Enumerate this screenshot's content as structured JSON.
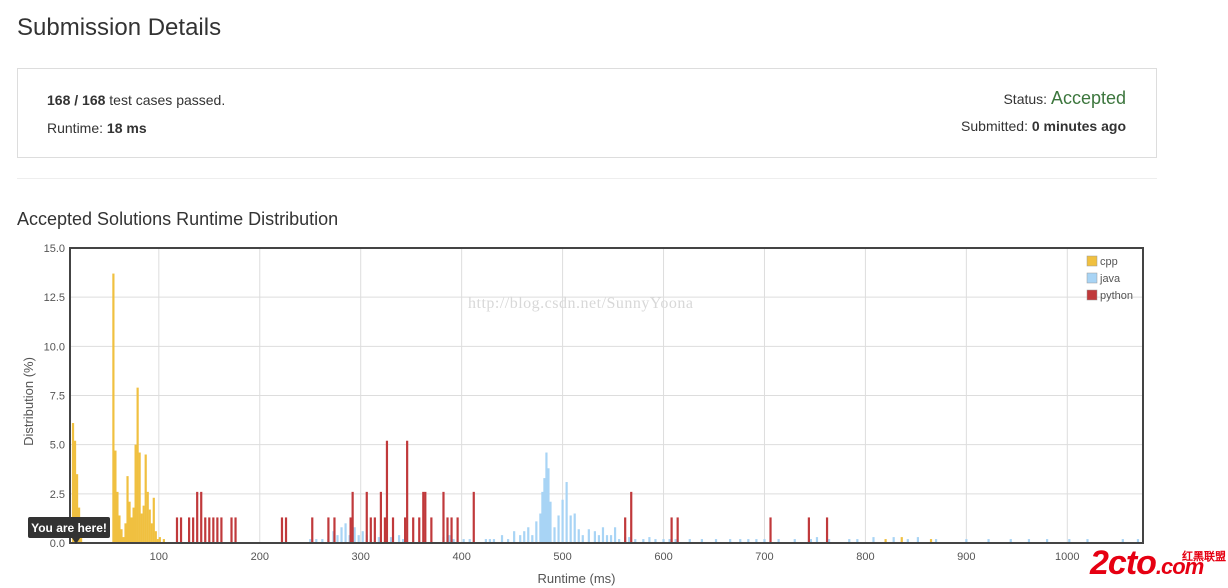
{
  "page": {
    "title": "Submission Details"
  },
  "summary": {
    "passed": "168 / 168",
    "passed_suffix": " test cases passed.",
    "runtime_label": "Runtime: ",
    "runtime_value": "18 ms",
    "status_label": "Status: ",
    "status_value": "Accepted",
    "submitted_label": "Submitted: ",
    "submitted_value": "0 minutes ago",
    "status_color": "#3c763d"
  },
  "chart_title": "Accepted Solutions Runtime Distribution",
  "watermark": "http://blog.csdn.net/SunnyYoona",
  "logo": {
    "main": "2cto",
    "tld": ".com",
    "sub": "红黑联盟"
  },
  "chart_data": {
    "type": "bar",
    "title": "Accepted Solutions Runtime Distribution",
    "xlabel": "Runtime (ms)",
    "ylabel": "Distribution (%)",
    "xlim": [
      12,
      1075
    ],
    "ylim": [
      0,
      15
    ],
    "x_ticks": [
      "100",
      "200",
      "300",
      "400",
      "500",
      "600",
      "700",
      "800",
      "900",
      "1000"
    ],
    "x_tick_values": [
      100,
      200,
      300,
      400,
      500,
      600,
      700,
      800,
      900,
      1000
    ],
    "y_ticks": [
      "0.0",
      "2.5",
      "5.0",
      "7.5",
      "10.0",
      "12.5",
      "15.0"
    ],
    "y_tick_values": [
      0,
      2.5,
      5,
      7.5,
      10,
      12.5,
      15
    ],
    "grid": true,
    "legend_position": "top-right",
    "annotation": {
      "text": "You are here!",
      "x": 18
    },
    "series": [
      {
        "name": "cpp",
        "color": "#f0c040",
        "points": [
          [
            15,
            6.1
          ],
          [
            17,
            5.2
          ],
          [
            19,
            3.5
          ],
          [
            21,
            1.8
          ],
          [
            23,
            1.0
          ],
          [
            55,
            13.7
          ],
          [
            57,
            4.7
          ],
          [
            59,
            2.6
          ],
          [
            61,
            1.4
          ],
          [
            63,
            0.7
          ],
          [
            65,
            0.3
          ],
          [
            67,
            1.0
          ],
          [
            69,
            3.4
          ],
          [
            71,
            2.1
          ],
          [
            73,
            1.3
          ],
          [
            75,
            1.8
          ],
          [
            77,
            5.0
          ],
          [
            79,
            7.9
          ],
          [
            81,
            4.6
          ],
          [
            83,
            1.5
          ],
          [
            85,
            1.9
          ],
          [
            87,
            4.5
          ],
          [
            89,
            2.6
          ],
          [
            91,
            1.7
          ],
          [
            93,
            1.0
          ],
          [
            95,
            2.3
          ],
          [
            97,
            0.6
          ],
          [
            99,
            0.2
          ],
          [
            101,
            0.3
          ],
          [
            105,
            0.2
          ],
          [
            820,
            0.2
          ],
          [
            836,
            0.3
          ],
          [
            865,
            0.2
          ]
        ]
      },
      {
        "name": "java",
        "color": "#a8d4f5",
        "points": [
          [
            250,
            0.2
          ],
          [
            256,
            0.2
          ],
          [
            262,
            0.2
          ],
          [
            268,
            0.2
          ],
          [
            273,
            0.6
          ],
          [
            277,
            0.4
          ],
          [
            281,
            0.8
          ],
          [
            285,
            1.0
          ],
          [
            289,
            0.4
          ],
          [
            294,
            0.8
          ],
          [
            298,
            0.4
          ],
          [
            302,
            0.6
          ],
          [
            306,
            0.4
          ],
          [
            310,
            0.2
          ],
          [
            318,
            0.3
          ],
          [
            330,
            0.3
          ],
          [
            338,
            0.4
          ],
          [
            342,
            0.2
          ],
          [
            382,
            0.3
          ],
          [
            388,
            0.4
          ],
          [
            392,
            0.2
          ],
          [
            402,
            0.2
          ],
          [
            408,
            0.2
          ],
          [
            424,
            0.2
          ],
          [
            428,
            0.2
          ],
          [
            432,
            0.2
          ],
          [
            440,
            0.4
          ],
          [
            446,
            0.2
          ],
          [
            452,
            0.6
          ],
          [
            458,
            0.4
          ],
          [
            462,
            0.6
          ],
          [
            466,
            0.8
          ],
          [
            470,
            0.4
          ],
          [
            474,
            1.1
          ],
          [
            478,
            1.5
          ],
          [
            480,
            2.6
          ],
          [
            482,
            3.3
          ],
          [
            484,
            4.6
          ],
          [
            486,
            3.8
          ],
          [
            488,
            2.1
          ],
          [
            492,
            0.8
          ],
          [
            496,
            1.4
          ],
          [
            500,
            2.2
          ],
          [
            504,
            3.1
          ],
          [
            508,
            1.4
          ],
          [
            512,
            1.5
          ],
          [
            516,
            0.7
          ],
          [
            520,
            0.4
          ],
          [
            526,
            0.7
          ],
          [
            532,
            0.6
          ],
          [
            536,
            0.4
          ],
          [
            540,
            0.8
          ],
          [
            544,
            0.4
          ],
          [
            548,
            0.4
          ],
          [
            552,
            0.8
          ],
          [
            556,
            0.2
          ],
          [
            562,
            0.3
          ],
          [
            566,
            0.3
          ],
          [
            572,
            0.2
          ],
          [
            580,
            0.2
          ],
          [
            586,
            0.3
          ],
          [
            592,
            0.2
          ],
          [
            600,
            0.2
          ],
          [
            606,
            0.2
          ],
          [
            612,
            0.2
          ],
          [
            626,
            0.2
          ],
          [
            638,
            0.2
          ],
          [
            652,
            0.2
          ],
          [
            666,
            0.2
          ],
          [
            676,
            0.2
          ],
          [
            684,
            0.2
          ],
          [
            692,
            0.2
          ],
          [
            700,
            0.2
          ],
          [
            714,
            0.2
          ],
          [
            730,
            0.2
          ],
          [
            746,
            0.2
          ],
          [
            752,
            0.3
          ],
          [
            764,
            0.2
          ],
          [
            784,
            0.2
          ],
          [
            792,
            0.2
          ],
          [
            808,
            0.3
          ],
          [
            828,
            0.3
          ],
          [
            842,
            0.2
          ],
          [
            852,
            0.3
          ],
          [
            870,
            0.2
          ],
          [
            900,
            0.2
          ],
          [
            922,
            0.2
          ],
          [
            944,
            0.2
          ],
          [
            962,
            0.2
          ],
          [
            980,
            0.2
          ],
          [
            1002,
            0.2
          ],
          [
            1020,
            0.2
          ],
          [
            1055,
            0.2
          ],
          [
            1070,
            0.2
          ]
        ]
      },
      {
        "name": "python",
        "color": "#c0393b",
        "points": [
          [
            118,
            1.3
          ],
          [
            122,
            1.3
          ],
          [
            130,
            1.3
          ],
          [
            134,
            1.3
          ],
          [
            138,
            2.6
          ],
          [
            142,
            2.6
          ],
          [
            146,
            1.3
          ],
          [
            150,
            1.3
          ],
          [
            154,
            1.3
          ],
          [
            158,
            1.3
          ],
          [
            162,
            1.3
          ],
          [
            172,
            1.3
          ],
          [
            176,
            1.3
          ],
          [
            222,
            1.3
          ],
          [
            226,
            1.3
          ],
          [
            252,
            1.3
          ],
          [
            268,
            1.3
          ],
          [
            274,
            1.3
          ],
          [
            290,
            1.3
          ],
          [
            292,
            2.6
          ],
          [
            306,
            2.6
          ],
          [
            310,
            1.3
          ],
          [
            314,
            1.3
          ],
          [
            320,
            2.6
          ],
          [
            324,
            1.3
          ],
          [
            326,
            5.2
          ],
          [
            332,
            1.3
          ],
          [
            344,
            1.3
          ],
          [
            346,
            5.2
          ],
          [
            352,
            1.3
          ],
          [
            358,
            1.3
          ],
          [
            362,
            2.6
          ],
          [
            364,
            2.6
          ],
          [
            370,
            1.3
          ],
          [
            382,
            2.6
          ],
          [
            386,
            1.3
          ],
          [
            390,
            1.3
          ],
          [
            396,
            1.3
          ],
          [
            412,
            2.6
          ],
          [
            562,
            1.3
          ],
          [
            568,
            2.6
          ],
          [
            608,
            1.3
          ],
          [
            614,
            1.3
          ],
          [
            706,
            1.3
          ],
          [
            744,
            1.3
          ],
          [
            762,
            1.3
          ]
        ]
      }
    ]
  }
}
